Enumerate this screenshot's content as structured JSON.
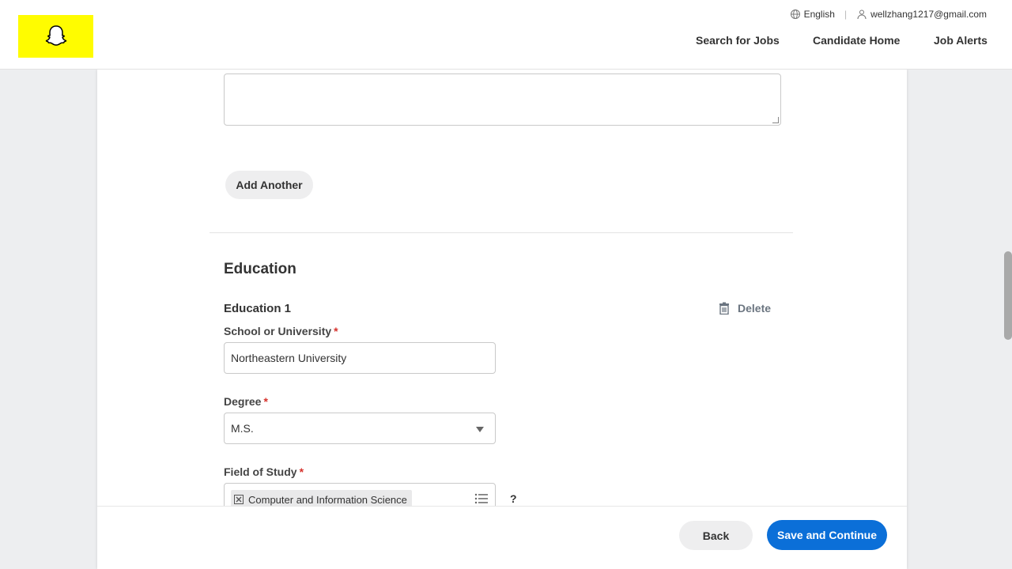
{
  "header": {
    "logo_alt": "Snapchat ghost",
    "language": "English",
    "user_email": "wellzhang1217@gmail.com",
    "nav": {
      "search_jobs": "Search for Jobs",
      "candidate_home": "Candidate Home",
      "job_alerts": "Job Alerts"
    }
  },
  "form": {
    "previous_textarea_value": "",
    "add_another_label": "Add Another",
    "education_section_title": "Education",
    "education_entry_title": "Education 1",
    "delete_label": "Delete",
    "school": {
      "label": "School or University",
      "required_mark": "*",
      "value": "Northeastern University"
    },
    "degree": {
      "label": "Degree",
      "required_mark": "*",
      "value": "M.S."
    },
    "field_of_study": {
      "label": "Field of Study",
      "required_mark": "*",
      "selected": [
        "Computer and Information Science"
      ]
    },
    "help_icon": "?"
  },
  "footer": {
    "back_label": "Back",
    "save_label": "Save and Continue"
  },
  "colors": {
    "brand_yellow": "#fffc00",
    "primary_blue": "#0b6fd8",
    "required_red": "#d6322c"
  },
  "icons": [
    "snapchat-ghost-icon",
    "globe-icon",
    "user-icon",
    "trash-icon",
    "chip-remove-icon",
    "list-icon",
    "help-icon"
  ]
}
